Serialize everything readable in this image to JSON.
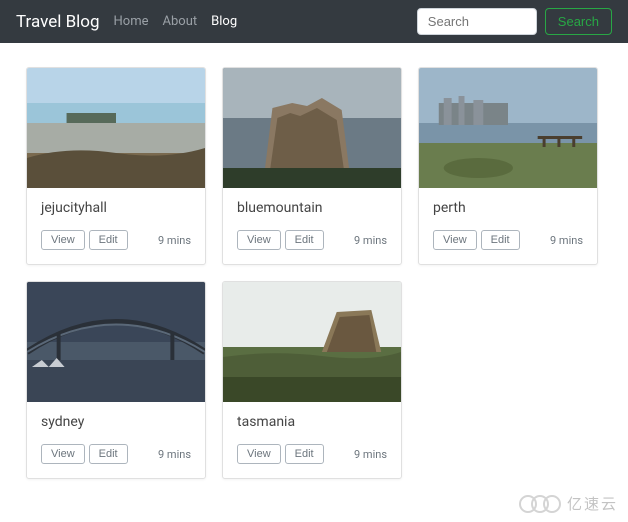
{
  "nav": {
    "brand": "Travel Blog",
    "links": [
      {
        "label": "Home",
        "active": false
      },
      {
        "label": "About",
        "active": false
      },
      {
        "label": "Blog",
        "active": true
      }
    ],
    "search_placeholder": "Search",
    "search_button": "Search"
  },
  "cards": [
    {
      "title": "jejucityhall",
      "view": "View",
      "edit": "Edit",
      "time": "9 mins"
    },
    {
      "title": "bluemountain",
      "view": "View",
      "edit": "Edit",
      "time": "9 mins"
    },
    {
      "title": "perth",
      "view": "View",
      "edit": "Edit",
      "time": "9 mins"
    },
    {
      "title": "sydney",
      "view": "View",
      "edit": "Edit",
      "time": "9 mins"
    },
    {
      "title": "tasmania",
      "view": "View",
      "edit": "Edit",
      "time": "9 mins"
    }
  ],
  "watermark": "亿速云"
}
